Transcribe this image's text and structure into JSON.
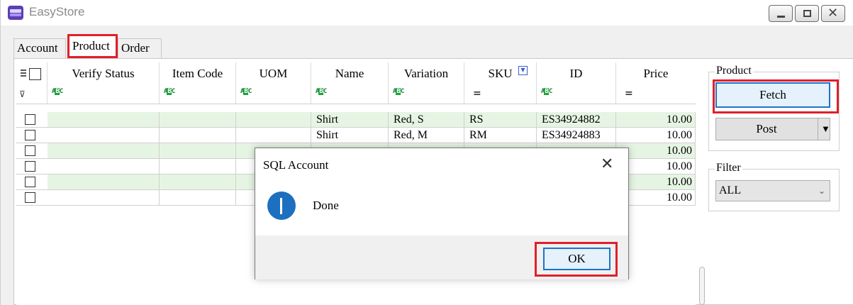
{
  "window": {
    "title": "EasyStore"
  },
  "tabs": [
    {
      "label": "Account"
    },
    {
      "label": "Product"
    },
    {
      "label": "Order"
    }
  ],
  "grid": {
    "columns": [
      {
        "label": "Verify Status",
        "filter": "text"
      },
      {
        "label": "Item Code",
        "filter": "text"
      },
      {
        "label": "UOM",
        "filter": "text"
      },
      {
        "label": "Name",
        "filter": "text"
      },
      {
        "label": "Variation",
        "filter": "text"
      },
      {
        "label": "SKU",
        "filter": "equals"
      },
      {
        "label": "ID",
        "filter": "text"
      },
      {
        "label": "Price",
        "filter": "equals"
      }
    ],
    "rows": [
      {
        "verify": "",
        "item_code": "",
        "uom": "",
        "name": "Shirt",
        "variation": "Red, S",
        "sku": "RS",
        "id": "ES34924882",
        "price": "10.00"
      },
      {
        "verify": "",
        "item_code": "",
        "uom": "",
        "name": "Shirt",
        "variation": "Red, M",
        "sku": "RM",
        "id": "ES34924883",
        "price": "10.00"
      },
      {
        "verify": "",
        "item_code": "",
        "uom": "",
        "name": "",
        "variation": "",
        "sku": "",
        "id": "",
        "price": "10.00"
      },
      {
        "verify": "",
        "item_code": "",
        "uom": "",
        "name": "",
        "variation": "",
        "sku": "",
        "id": "",
        "price": "10.00"
      },
      {
        "verify": "",
        "item_code": "",
        "uom": "",
        "name": "",
        "variation": "",
        "sku": "",
        "id": "",
        "price": "10.00"
      },
      {
        "verify": "",
        "item_code": "",
        "uom": "",
        "name": "",
        "variation": "",
        "sku": "",
        "id": "",
        "price": "10.00"
      }
    ]
  },
  "product_group": {
    "label": "Product",
    "fetch_label": "Fetch",
    "post_label": "Post"
  },
  "filter_group": {
    "label": "Filter",
    "selected": "ALL"
  },
  "dialog": {
    "title": "SQL Account",
    "message": "Done",
    "ok_label": "OK"
  },
  "colors": {
    "highlight": "#e0202a",
    "alt_row": "#e6f5e3",
    "focus_border": "#1d73c8"
  }
}
